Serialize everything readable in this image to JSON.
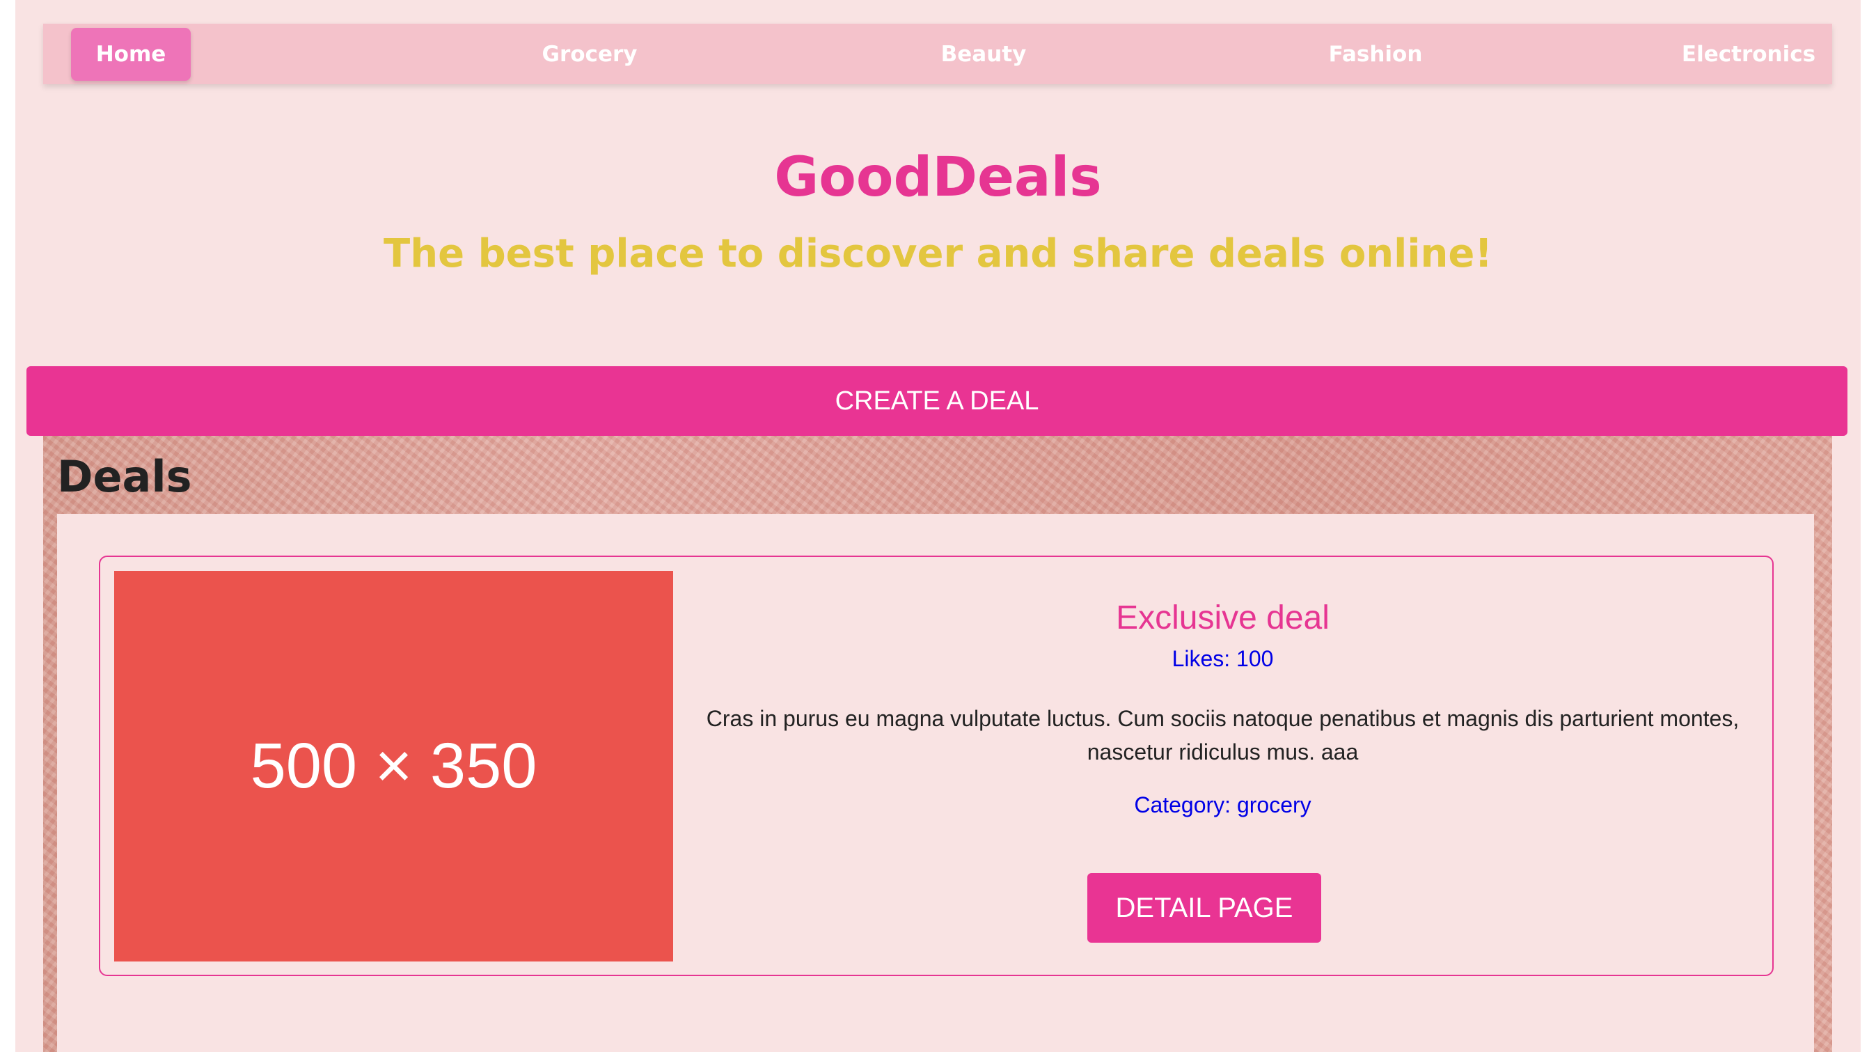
{
  "nav": {
    "items": [
      {
        "label": "Home",
        "active": true
      },
      {
        "label": "Grocery",
        "active": false
      },
      {
        "label": "Beauty",
        "active": false
      },
      {
        "label": "Fashion",
        "active": false
      },
      {
        "label": "Electronics",
        "active": false
      }
    ]
  },
  "hero": {
    "title": "GoodDeals",
    "tagline": "The best place to discover and share deals online!"
  },
  "create_button_label": "CREATE A DEAL",
  "deals": {
    "heading": "Deals",
    "items": [
      {
        "image_placeholder": "500 × 350",
        "title": "Exclusive deal",
        "likes": "Likes: 100",
        "description": "Cras in purus eu magna vulputate luctus. Cum sociis natoque penatibus et magnis dis parturient montes, nascetur ridiculus mus. aaa",
        "category": "Category: grocery",
        "detail_button_label": "DETAIL PAGE"
      }
    ]
  },
  "colors": {
    "accent_pink": "#e93493",
    "nav_bg": "#f4c2cb",
    "nav_active": "#ee74b8",
    "tagline_yellow": "#e3c63f",
    "link_blue": "#0000e6",
    "placeholder_red": "#eb534d",
    "page_bg": "#f9e3e3"
  }
}
